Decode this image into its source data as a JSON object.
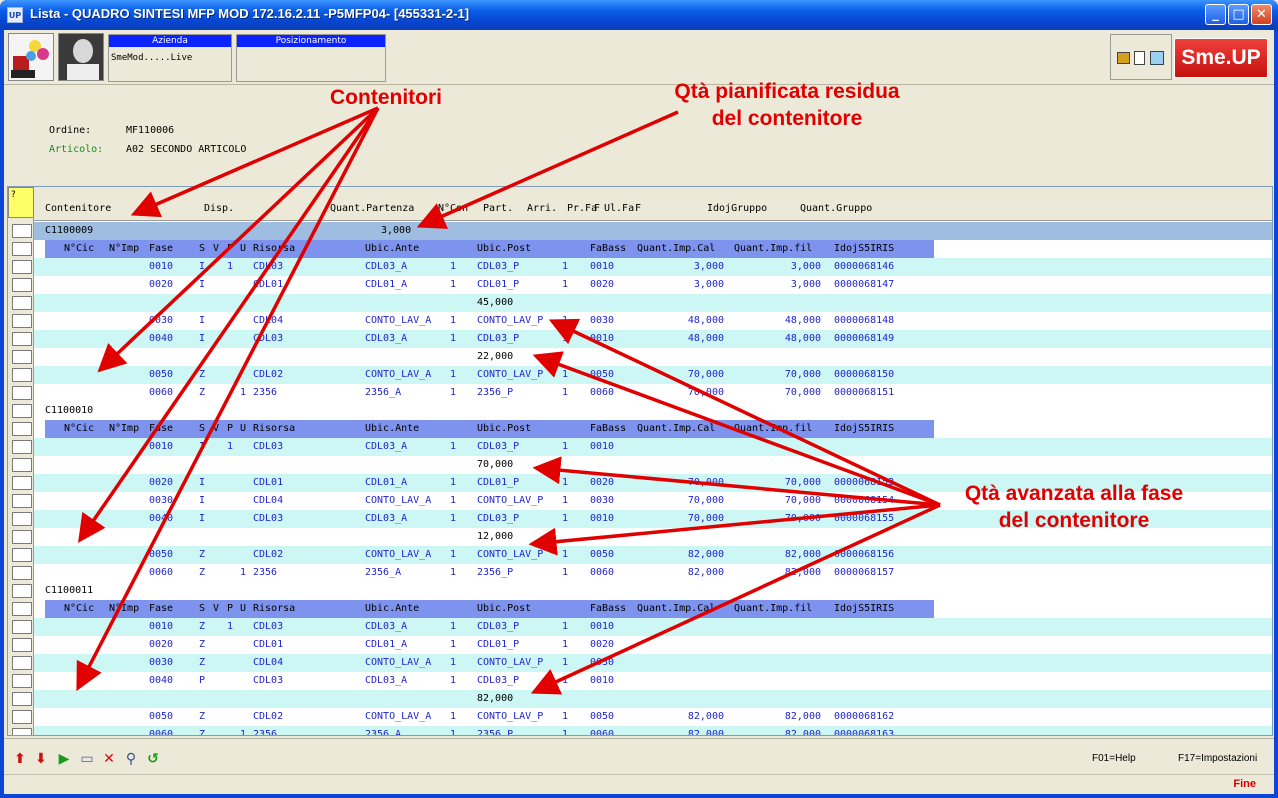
{
  "window": {
    "app_icon": "UP",
    "title": "Lista -  QUADRO SINTESI MFP MOD 172.16.2.11 -P5MFP04- [455331-2-1]"
  },
  "header": {
    "azienda_caption": "Azienda",
    "azienda_value": "SmeMod.....Live",
    "posizionamento_caption": "Posizionamento",
    "posizionamento_value": "",
    "brand": "Sme.UP"
  },
  "panel": {
    "ordine_label": "Ordine:",
    "ordine_value": "MF110006",
    "articolo_label": "Articolo:",
    "articolo_value": "A02 SECONDO ARTICOLO"
  },
  "grid": {
    "corner": "?",
    "columns": [
      "Contenitore",
      "Disp.",
      "Quant.Partenza",
      "N°Con",
      "Part.",
      "Arri.",
      "Pr.Fa",
      "F",
      "Ul.Fa",
      "F",
      "IdojGruppo",
      "Quant.Gruppo"
    ],
    "sub_columns": [
      "N°Cic",
      "N°Imp",
      "Fase",
      "S",
      "V",
      "P",
      "U",
      "Risorsa",
      "Ubic.Ante",
      "Ubic.Post",
      "FaBass",
      "Quant.Imp.Cal",
      "Quant.Imp.fil",
      "IdojS5IRIS"
    ],
    "rows": [
      {
        "type": "grp",
        "code": "C1100009",
        "qty": "3,000"
      },
      {
        "type": "sub"
      },
      {
        "type": "det",
        "bg": "cyan",
        "c": [
          "",
          "",
          "0010",
          "I",
          "1",
          "",
          "CDL03",
          "CDL03_A",
          "1",
          "CDL03_P",
          "1",
          "0010",
          "3,000",
          "3,000",
          "0000068146"
        ]
      },
      {
        "type": "det",
        "bg": "white",
        "c": [
          "",
          "",
          "0020",
          "I",
          "",
          "",
          "CDL01",
          "CDL01_A",
          "1",
          "CDL01_P",
          "1",
          "0020",
          "3,000",
          "3,000",
          "0000068147"
        ]
      },
      {
        "type": "qty",
        "bg": "cyan",
        "q": "45,000"
      },
      {
        "type": "det",
        "bg": "white",
        "c": [
          "",
          "",
          "0030",
          "I",
          "",
          "",
          "CDL04",
          "CONTO_LAV_A",
          "1",
          "CONTO_LAV_P",
          "1",
          "0030",
          "48,000",
          "48,000",
          "0000068148"
        ]
      },
      {
        "type": "det",
        "bg": "cyan",
        "c": [
          "",
          "",
          "0040",
          "I",
          "",
          "",
          "CDL03",
          "CDL03_A",
          "1",
          "CDL03_P",
          "1",
          "0010",
          "48,000",
          "48,000",
          "0000068149"
        ]
      },
      {
        "type": "qty",
        "bg": "white",
        "q": "22,000"
      },
      {
        "type": "det",
        "bg": "cyan",
        "c": [
          "",
          "",
          "0050",
          "Z",
          "",
          "",
          "CDL02",
          "CONTO_LAV_A",
          "1",
          "CONTO_LAV_P",
          "1",
          "0050",
          "70,000",
          "70,000",
          "0000068150"
        ]
      },
      {
        "type": "det",
        "bg": "white",
        "c": [
          "",
          "",
          "0060",
          "Z",
          "",
          "1",
          "2356",
          "2356_A",
          "1",
          "2356_P",
          "1",
          "0060",
          "70,000",
          "70,000",
          "0000068151"
        ]
      },
      {
        "type": "grp2",
        "code": "C1100010"
      },
      {
        "type": "sub"
      },
      {
        "type": "det",
        "bg": "cyan",
        "c": [
          "",
          "",
          "0010",
          "I",
          "1",
          "",
          "CDL03",
          "CDL03_A",
          "1",
          "CDL03_P",
          "1",
          "0010",
          "",
          "",
          ""
        ]
      },
      {
        "type": "qty",
        "bg": "white",
        "q": "70,000"
      },
      {
        "type": "det",
        "bg": "cyan",
        "c": [
          "",
          "",
          "0020",
          "I",
          "",
          "",
          "CDL01",
          "CDL01_A",
          "1",
          "CDL01_P",
          "1",
          "0020",
          "70,000",
          "70,000",
          "0000068153"
        ]
      },
      {
        "type": "det",
        "bg": "white",
        "c": [
          "",
          "",
          "0030",
          "I",
          "",
          "",
          "CDL04",
          "CONTO_LAV_A",
          "1",
          "CONTO_LAV_P",
          "1",
          "0030",
          "70,000",
          "70,000",
          "0000068154"
        ]
      },
      {
        "type": "det",
        "bg": "cyan",
        "c": [
          "",
          "",
          "0040",
          "I",
          "",
          "",
          "CDL03",
          "CDL03_A",
          "1",
          "CDL03_P",
          "1",
          "0010",
          "70,000",
          "70,000",
          "0000068155"
        ]
      },
      {
        "type": "qty",
        "bg": "white",
        "q": "12,000"
      },
      {
        "type": "det",
        "bg": "cyan",
        "c": [
          "",
          "",
          "0050",
          "Z",
          "",
          "",
          "CDL02",
          "CONTO_LAV_A",
          "1",
          "CONTO_LAV_P",
          "1",
          "0050",
          "82,000",
          "82,000",
          "0000068156"
        ]
      },
      {
        "type": "det",
        "bg": "white",
        "c": [
          "",
          "",
          "0060",
          "Z",
          "",
          "1",
          "2356",
          "2356_A",
          "1",
          "2356_P",
          "1",
          "0060",
          "82,000",
          "82,000",
          "0000068157"
        ]
      },
      {
        "type": "grp2",
        "code": "C1100011"
      },
      {
        "type": "sub"
      },
      {
        "type": "det",
        "bg": "cyan",
        "c": [
          "",
          "",
          "0010",
          "Z",
          "1",
          "",
          "CDL03",
          "CDL03_A",
          "1",
          "CDL03_P",
          "1",
          "0010",
          "",
          "",
          ""
        ]
      },
      {
        "type": "det",
        "bg": "white",
        "c": [
          "",
          "",
          "0020",
          "Z",
          "",
          "",
          "CDL01",
          "CDL01_A",
          "1",
          "CDL01_P",
          "1",
          "0020",
          "",
          "",
          ""
        ]
      },
      {
        "type": "det",
        "bg": "cyan",
        "c": [
          "",
          "",
          "0030",
          "Z",
          "",
          "",
          "CDL04",
          "CONTO_LAV_A",
          "1",
          "CONTO_LAV_P",
          "1",
          "0030",
          "",
          "",
          ""
        ]
      },
      {
        "type": "det",
        "bg": "white",
        "c": [
          "",
          "",
          "0040",
          "P",
          "",
          "",
          "CDL03",
          "CDL03_A",
          "1",
          "CDL03_P",
          "1",
          "0010",
          "",
          "",
          ""
        ]
      },
      {
        "type": "qty",
        "bg": "cyan",
        "q": "82,000"
      },
      {
        "type": "det",
        "bg": "white",
        "c": [
          "",
          "",
          "0050",
          "Z",
          "",
          "",
          "CDL02",
          "CONTO_LAV_A",
          "1",
          "CONTO_LAV_P",
          "1",
          "0050",
          "82,000",
          "82,000",
          "0000068162"
        ]
      },
      {
        "type": "det",
        "bg": "cyan",
        "c": [
          "",
          "",
          "0060",
          "Z",
          "",
          "1",
          "2356",
          "2356_A",
          "1",
          "2356_P",
          "1",
          "0060",
          "82,000",
          "82,000",
          "0000068163"
        ]
      }
    ]
  },
  "bottom": {
    "icons": [
      "arrow-up-icon",
      "arrow-down-icon",
      "play-icon",
      "eraser-icon",
      "delete-icon",
      "search-icon",
      "refresh-icon"
    ],
    "help": "F01=Help",
    "settings": "F17=Impostazioni",
    "status": "Fine"
  },
  "annotations": {
    "contenitori": "Contenitori",
    "qta_pianificata_1": "Qtà pianificata residua",
    "qta_pianificata_2": "del contenitore",
    "qta_avanzata_1": "Qtà avanzata alla fase",
    "qta_avanzata_2": "del contenitore",
    "color": "#e00000"
  }
}
